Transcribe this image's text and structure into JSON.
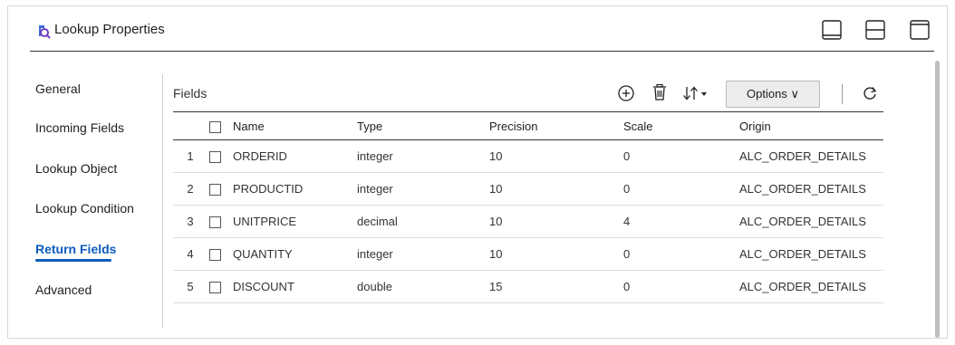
{
  "header": {
    "title": "Lookup Properties",
    "icon": "lookup-properties-icon",
    "layout_buttons": [
      "panel-bottom-icon",
      "panel-split-icon",
      "panel-top-icon"
    ]
  },
  "nav": {
    "items": [
      {
        "label": "General",
        "active": false
      },
      {
        "label": "Incoming Fields",
        "active": false
      },
      {
        "label": "Lookup Object",
        "active": false
      },
      {
        "label": "Lookup Condition",
        "active": false
      },
      {
        "label": "Return Fields",
        "active": true
      },
      {
        "label": "Advanced",
        "active": false
      }
    ]
  },
  "fields": {
    "label": "Fields",
    "toolbar": {
      "add_icon": "add-circle-icon",
      "delete_icon": "trash-icon",
      "sort_icon": "sort-icon",
      "options_label": "Options ∨",
      "refresh_icon": "refresh-icon"
    },
    "columns": [
      "Name",
      "Type",
      "Precision",
      "Scale",
      "Origin"
    ],
    "rows": [
      {
        "num": "1",
        "name": "ORDERID",
        "type": "integer",
        "precision": "10",
        "scale": "0",
        "origin": "ALC_ORDER_DETAILS"
      },
      {
        "num": "2",
        "name": "PRODUCTID",
        "type": "integer",
        "precision": "10",
        "scale": "0",
        "origin": "ALC_ORDER_DETAILS"
      },
      {
        "num": "3",
        "name": "UNITPRICE",
        "type": "decimal",
        "precision": "10",
        "scale": "4",
        "origin": "ALC_ORDER_DETAILS"
      },
      {
        "num": "4",
        "name": "QUANTITY",
        "type": "integer",
        "precision": "10",
        "scale": "0",
        "origin": "ALC_ORDER_DETAILS"
      },
      {
        "num": "5",
        "name": "DISCOUNT",
        "type": "double",
        "precision": "15",
        "scale": "0",
        "origin": "ALC_ORDER_DETAILS"
      }
    ]
  },
  "colors": {
    "accent": "#0b5cbd",
    "icon_purple": "#6b3fc1",
    "icon_blue": "#3b6bd6"
  }
}
